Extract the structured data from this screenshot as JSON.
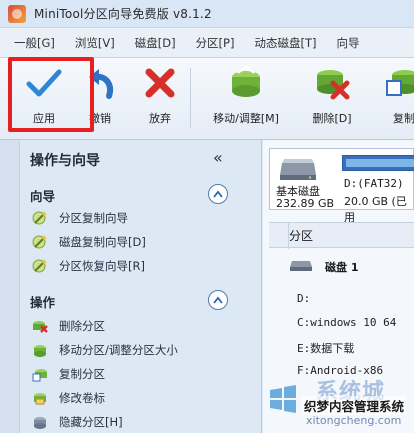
{
  "window": {
    "title": "MiniTool分区向导免费版 v8.1.2"
  },
  "menu": [
    "一般[G]",
    "浏览[V]",
    "磁盘[D]",
    "分区[P]",
    "动态磁盘[T]",
    "向导"
  ],
  "toolbar": {
    "apply": "应用",
    "undo": "撤销",
    "discard": "放弃",
    "move_resize": "移动/调整[M]",
    "delete": "删除[D]",
    "copy": "复制"
  },
  "left_panel": {
    "header": "操作与向导",
    "collapse_glyph": "«",
    "wizard_section": "向导",
    "wizard_items": [
      "分区复制向导",
      "磁盘复制向导[D]",
      "分区恢复向导[R]"
    ],
    "ops_section": "操作",
    "ops_items": [
      "删除分区",
      "移动分区/调整分区大小",
      "复制分区",
      "修改卷标",
      "隐藏分区[H]"
    ]
  },
  "disk_card": {
    "name": "基本磁盘",
    "size": "232.89 GB",
    "partition_label": "D:(FAT32)",
    "partition_size": "20.0 GB (已用"
  },
  "list": {
    "column": "分区",
    "disk_row": "磁盘 1",
    "rows": [
      "D:",
      "C:windows 10  64",
      "E:数据下载",
      "F:Android-x86"
    ]
  },
  "watermark": {
    "big": "系统城",
    "mid": "织梦内容管理系统",
    "small": "xitongcheng.com"
  },
  "colors": {
    "highlight": "#e6201f",
    "accent": "#3a6fbf"
  }
}
